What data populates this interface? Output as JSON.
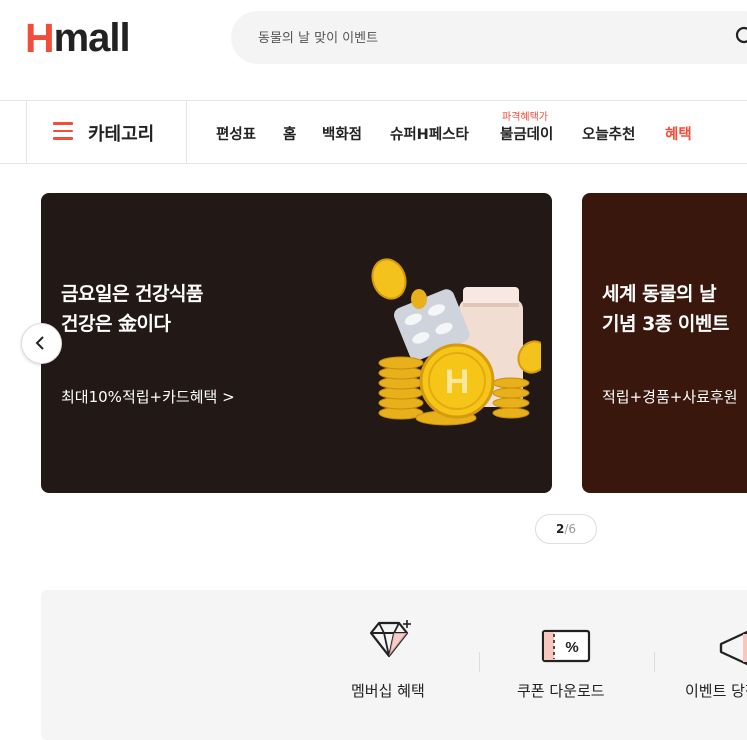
{
  "header": {
    "logo_h": "H",
    "logo_rest": "mall",
    "search_placeholder": "동물의 날 맞이 이벤트"
  },
  "nav": {
    "category_label": "카테고리",
    "items": [
      "편성표",
      "홈",
      "백화점",
      "슈퍼H페스타",
      "불금데이",
      "오늘추천",
      "혜택"
    ],
    "badge": "파격혜택가"
  },
  "banners": [
    {
      "title_line1": "금요일은 건강식품",
      "title_line2": "건강은 金이다",
      "subtitle": "최대10%적립+카드혜택 >",
      "background": "#221916"
    },
    {
      "title_line1": "세계 동물의 날",
      "title_line2": "기념 3종 이벤트",
      "subtitle": "적립+경품+사료후원",
      "background": "#3a170c"
    }
  ],
  "pager": {
    "current": "2",
    "total": "/6"
  },
  "benefits": [
    "멤버십 혜택",
    "쿠폰 다운로드",
    "이벤트 당첨"
  ],
  "colors": {
    "accent": "#f04d3a",
    "text": "#222222"
  }
}
